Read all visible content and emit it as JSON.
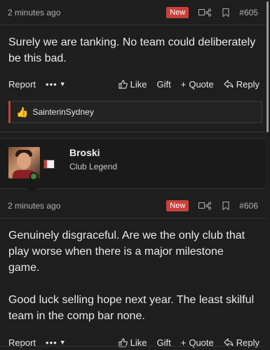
{
  "post1": {
    "time": "2 minutes ago",
    "badge": "New",
    "number": "#605",
    "message": "Surely we are tanking. No team could deliberately be this bad.",
    "actions": {
      "report": "Report",
      "more": "•••",
      "like": "Like",
      "gift": "Gift",
      "quote": "Quote",
      "reply": "Reply"
    },
    "liked_by": "SainterinSydney"
  },
  "user": {
    "name": "Broski",
    "title": "Club Legend"
  },
  "post2": {
    "time": "2 minutes ago",
    "badge": "New",
    "number": "#606",
    "message_line1": "Genuinely disgraceful. Are we the only club that play worse when there is a major milestone game.",
    "message_line2": "Good luck selling hope next year. The least skilful team in the comp bar none.",
    "actions": {
      "report": "Report",
      "more": "•••",
      "like": "Like",
      "gift": "Gift",
      "quote": "Quote",
      "reply": "Reply"
    }
  },
  "colors": {
    "accent": "#c9413a",
    "background": "#1e1e1e",
    "online": "#3f8a34"
  }
}
